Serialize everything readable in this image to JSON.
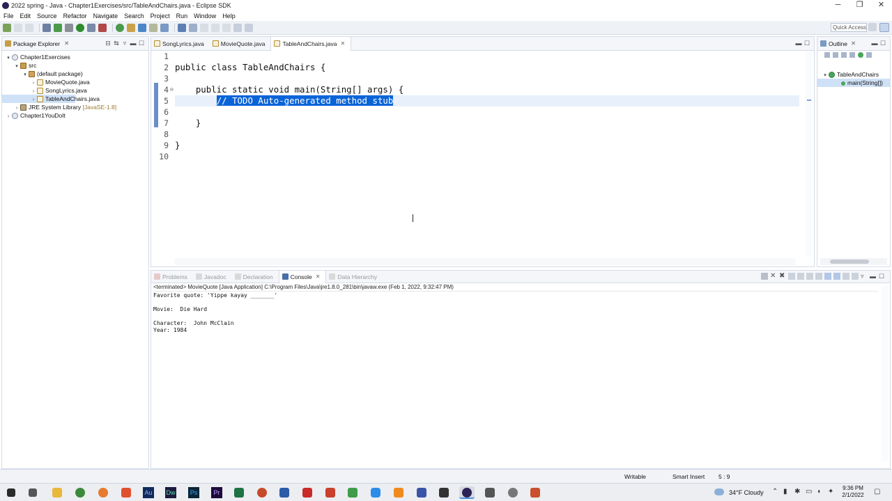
{
  "window": {
    "title": "2022 spring - Java - Chapter1Exercises/src/TableAndChairs.java - Eclipse SDK",
    "minimize": "─",
    "restore": "❐",
    "close": "✕"
  },
  "menu": [
    "File",
    "Edit",
    "Source",
    "Refactor",
    "Navigate",
    "Search",
    "Project",
    "Run",
    "Window",
    "Help"
  ],
  "toolbar": {
    "quick_access": "Quick Access"
  },
  "package_explorer": {
    "title": "Package Explorer",
    "tree": [
      {
        "label": "Chapter1Exercises",
        "icon": "project-icon",
        "arrow": "▾"
      },
      {
        "label": "src",
        "icon": "source-folder-icon",
        "arrow": "▾"
      },
      {
        "label": "(default package)",
        "icon": "package-icon",
        "arrow": "▾"
      },
      {
        "label": "MovieQuote.java",
        "icon": "java-file-icon",
        "arrow": "›"
      },
      {
        "label": "SongLyrics.java",
        "icon": "java-file-icon",
        "arrow": "›"
      },
      {
        "label": "TableAndChairs.java",
        "icon": "java-file-icon",
        "arrow": "›",
        "selected": true
      },
      {
        "label": "JRE System Library",
        "suffix": "[JavaSE-1.8]",
        "icon": "library-icon",
        "arrow": "›"
      },
      {
        "label": "Chapter1YouDoIt",
        "icon": "project-icon",
        "arrow": "›"
      }
    ]
  },
  "editor": {
    "tabs": [
      {
        "label": "SongLyrics.java",
        "active": false
      },
      {
        "label": "MovieQuote.java",
        "active": false
      },
      {
        "label": "TableAndChairs.java",
        "active": true
      }
    ],
    "lines": [
      {
        "n": "1",
        "code": ""
      },
      {
        "n": "2",
        "code": "public class TableAndChairs {"
      },
      {
        "n": "3",
        "code": ""
      },
      {
        "n": "4",
        "code": "    public static void main(String[] args) {",
        "fold": "⊖"
      },
      {
        "n": "5",
        "code": "        ",
        "selected": "// TODO Auto-generated method stub"
      },
      {
        "n": "6",
        "code": ""
      },
      {
        "n": "7",
        "code": "    }"
      },
      {
        "n": "8",
        "code": ""
      },
      {
        "n": "9",
        "code": "}"
      },
      {
        "n": "10",
        "code": ""
      }
    ]
  },
  "outline": {
    "title": "Outline",
    "items": [
      {
        "label": "TableAndChairs"
      },
      {
        "label": "main(String[])"
      }
    ]
  },
  "bottom_panel": {
    "tabs": [
      {
        "label": "Problems",
        "active": false
      },
      {
        "label": "Javadoc",
        "active": false
      },
      {
        "label": "Declaration",
        "active": false
      },
      {
        "label": "Console",
        "active": true
      },
      {
        "label": "Data Hierarchy",
        "active": false
      }
    ],
    "console_header": "<terminated> MovieQuote [Java Application] C:\\Program Files\\Java\\jre1.8.0_281\\bin\\javaw.exe (Feb 1, 2022, 9:32:47 PM)",
    "output": [
      "Favorite quote: 'Yippe kayay _______'",
      "",
      "Movie:  Die Hard",
      "",
      "Character:  John McClain",
      "Year: 1984"
    ]
  },
  "status": {
    "writable": "Writable",
    "insert_mode": "Smart Insert",
    "position": "5 : 9"
  },
  "taskbar": {
    "apps": [
      "Au",
      "Dw",
      "Ps",
      "Pr"
    ],
    "weather": "34°F  Cloudy",
    "time": "9:36 PM",
    "date": "2/1/2022"
  },
  "colors": {
    "selection": "#0a64d8",
    "tree_selection": "#cfe1f7",
    "accent": "#4a90d9"
  }
}
